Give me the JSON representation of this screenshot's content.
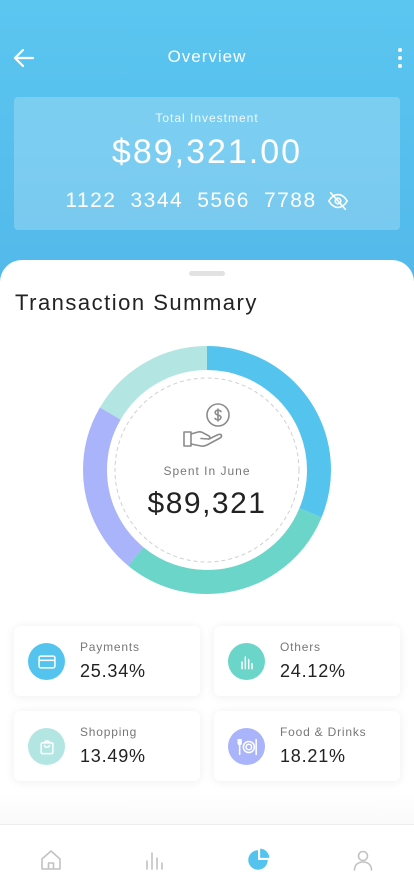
{
  "header": {
    "title": "Overview",
    "back_icon": "arrow-left-icon",
    "more_icon": "more-vertical-icon"
  },
  "investment": {
    "label": "Total Investment",
    "amount": "$89,321.00",
    "card_groups": [
      "1122",
      "3344",
      "5566",
      "7788"
    ],
    "visibility_icon": "eye-off-icon"
  },
  "summary": {
    "title": "Transaction Summary",
    "center_icon": "hand-coin-icon",
    "spent_label": "Spent In June",
    "spent_value": "$89,321"
  },
  "chart_data": {
    "type": "pie",
    "variant": "donut",
    "series": [
      {
        "name": "Payments",
        "value": 25.34,
        "color": "#54C4EE"
      },
      {
        "name": "Others",
        "value": 24.12,
        "color": "#6AD5C8"
      },
      {
        "name": "Food & Drinks",
        "value": 18.21,
        "color": "#A9B4FA"
      },
      {
        "name": "Shopping",
        "value": 13.49,
        "color": "#B3E6E2"
      }
    ]
  },
  "stats": [
    {
      "name": "Payments",
      "value": "25.34%",
      "icon": "credit-card-icon",
      "color": "#54C4EE"
    },
    {
      "name": "Others",
      "value": "24.12%",
      "icon": "bar-chart-icon",
      "color": "#6AD5C8"
    },
    {
      "name": "Shopping",
      "value": "13.49%",
      "icon": "shopping-bag-icon",
      "color": "#B3E6E2"
    },
    {
      "name": "Food & Drinks",
      "value": "18.21%",
      "icon": "plate-cutlery-icon",
      "color": "#A9B4FA"
    }
  ],
  "tabs": [
    {
      "icon": "home-icon",
      "active": false
    },
    {
      "icon": "bar-chart-icon",
      "active": false
    },
    {
      "icon": "pie-chart-icon",
      "active": true
    },
    {
      "icon": "user-icon",
      "active": false
    }
  ],
  "colors": {
    "accent": "#54C4EE",
    "inactive": "#C2C2C2"
  }
}
